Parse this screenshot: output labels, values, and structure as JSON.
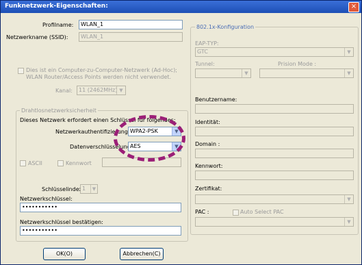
{
  "window": {
    "title": "Funknetzwerk-Eigenschaften:",
    "close_glyph": "×"
  },
  "profile": {
    "profilname_label": "Profilname:",
    "profilname_value": "WLAN_1",
    "ssid_label": "Netzwerkname (SSID):",
    "ssid_value": "WLAN_1"
  },
  "adhoc": {
    "line1": "Dies ist ein Computer-zu-Computer-Netzwerk (Ad-Hoc);",
    "line2": "WLAN Router/Access Points werden nicht verwendet."
  },
  "kanal": {
    "label": "Kanal:",
    "value": "11 (2462MHz)"
  },
  "security": {
    "title": "Drahtlosnetzwerksicherheit",
    "desc": "Dieses Netzwerk erfordert einen Schlüssel für folgendes:",
    "auth_label": "Netzwerkauthentifizierung:",
    "auth_value": "WPA2-PSK",
    "enc_label": "Datenverschlüsselung:",
    "enc_value": "AES",
    "ascii_label": "ASCII",
    "kennwort_label": "Kennwort",
    "schluesselindex_label": "Schlüsselindex:",
    "schluesselindex_value": "1",
    "key_label": "Netzwerkschlüssel:",
    "key_value": "•••••••••••",
    "key_confirm_label": "Netzwerkschlüssel bestätigen:",
    "key_confirm_value": "•••••••••••"
  },
  "eap": {
    "title": "802.1x-Konfiguration",
    "eap_typ_label": "EAP-TYP:",
    "eap_typ_value": "GTC",
    "tunnel_label": "Tunnel:",
    "prision_label": "Prision Mode :",
    "benutzername_label": "Benutzername:",
    "identitaet_label": "Identität:",
    "domain_label": "Domain :",
    "kennwort_label": "Kennwort:",
    "zertifikat_label": "Zertifikat:",
    "pac_label": "PAC :",
    "auto_pac_label": "Auto Select PAC"
  },
  "buttons": {
    "ok": "OK(O)",
    "cancel": "Abbrechen(C)"
  },
  "colors": {
    "titlebar": "#1d4fb5",
    "highlight": "#9b1f77",
    "dialog_bg": "#ece9d8"
  }
}
